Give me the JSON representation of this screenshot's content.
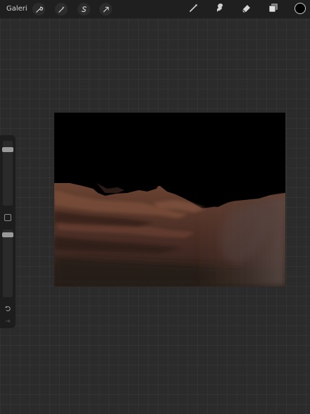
{
  "topbar": {
    "gallery_label": "Galeri",
    "left_tools": [
      {
        "icon": "wrench-icon",
        "name": "actions"
      },
      {
        "icon": "magic-wand-icon",
        "name": "adjustments"
      },
      {
        "icon": "selection-icon",
        "name": "selection"
      },
      {
        "icon": "transform-arrow-icon",
        "name": "transform"
      }
    ],
    "right_tools": [
      {
        "icon": "brush-icon",
        "name": "paint"
      },
      {
        "icon": "smudge-icon",
        "name": "smudge"
      },
      {
        "icon": "eraser-icon",
        "name": "erase"
      },
      {
        "icon": "layers-icon",
        "name": "layers"
      }
    ],
    "active_color": "#000000"
  },
  "sidebar": {
    "brush_size_level": 0.1,
    "opacity_level": 0.05,
    "undo_icon": "undo-icon",
    "redo_icon": "redo-icon"
  },
  "canvas": {
    "background_color": "#000000",
    "terrain_colors": [
      "#3a2520",
      "#6b4332",
      "#5a3a2c",
      "#4a3a36",
      "#2e201c"
    ]
  }
}
